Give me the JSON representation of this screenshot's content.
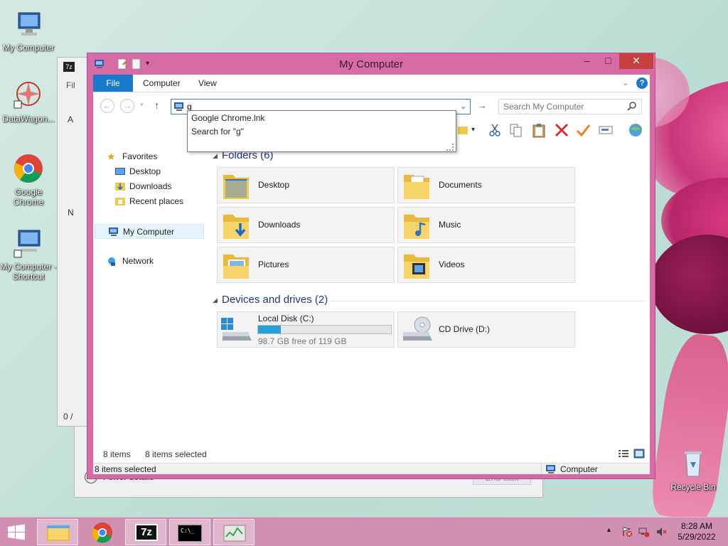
{
  "desktop": {
    "icons": [
      {
        "label": "My Computer"
      },
      {
        "label": "DataWagon..."
      },
      {
        "label": "Google Chrome"
      },
      {
        "label": "My Computer - Shortcut"
      },
      {
        "label": "Recycle Bin"
      }
    ]
  },
  "background_window": {
    "letters": [
      "Fil",
      "A",
      "N"
    ],
    "status": "0 /",
    "footer_left": "Fewer details",
    "footer_button": "End task"
  },
  "window": {
    "title": "My Computer",
    "tabs": [
      "File",
      "Computer",
      "View"
    ],
    "address_value": "g",
    "search_placeholder": "Search My Computer",
    "autocomplete": [
      "Google Chrome.lnk",
      "Search for \"g\""
    ],
    "nav": {
      "favorites": "Favorites",
      "favorites_items": [
        "Desktop",
        "Downloads",
        "Recent places"
      ],
      "my_computer": "My Computer",
      "network": "Network"
    },
    "folders_header": "Folders (6)",
    "folders": [
      "Desktop",
      "Documents",
      "Downloads",
      "Music",
      "Pictures",
      "Videos"
    ],
    "devices_header": "Devices and drives (2)",
    "drives": [
      {
        "name": "Local Disk (C:)",
        "free_text": "98.7 GB free of 119 GB",
        "used_fraction": 0.17
      },
      {
        "name": "CD Drive (D:)"
      }
    ],
    "inner_status": {
      "items": "8 items",
      "selected": "8 items selected"
    },
    "status_bar": {
      "left": "8 items selected",
      "right": "Computer"
    }
  },
  "taskbar": {
    "clock_time": "8:28 AM",
    "clock_date": "5/29/2022",
    "apps": [
      "file-explorer",
      "google-chrome",
      "7-zip",
      "command-prompt",
      "task-manager"
    ]
  },
  "colors": {
    "window_frame": "#d66ba6",
    "accent_blue": "#1979ca",
    "taskbar": "#d18fb1",
    "close_button": "#c7403d"
  }
}
